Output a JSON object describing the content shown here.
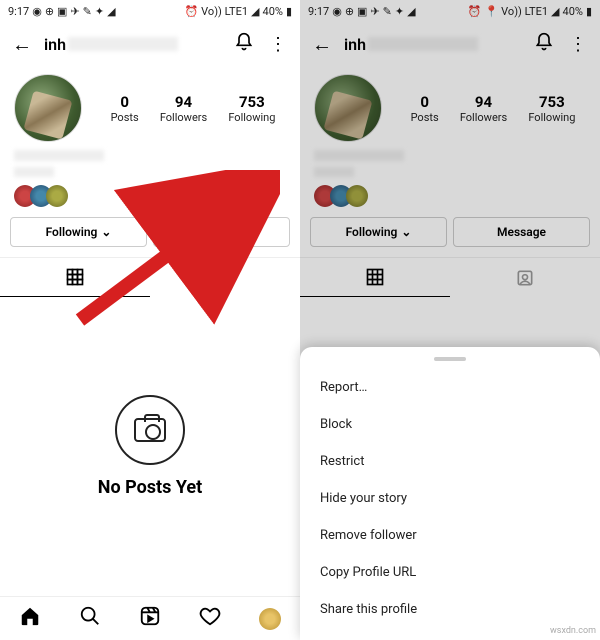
{
  "status": {
    "time": "9:17",
    "battery": "40%",
    "carrier": "Vo)) LTE1"
  },
  "header": {
    "username_prefix": "inh"
  },
  "stats": {
    "posts": {
      "num": "0",
      "lbl": "Posts"
    },
    "followers": {
      "num": "94",
      "lbl": "Followers"
    },
    "following": {
      "num": "753",
      "lbl": "Following"
    }
  },
  "actions": {
    "following": "Following",
    "message": "Message"
  },
  "empty": {
    "title": "No Posts Yet"
  },
  "sheet": {
    "report": "Report…",
    "block": "Block",
    "restrict": "Restrict",
    "hide": "Hide your story",
    "remove": "Remove follower",
    "copy": "Copy Profile URL",
    "share": "Share this profile"
  },
  "watermark": "wsxdn.com"
}
